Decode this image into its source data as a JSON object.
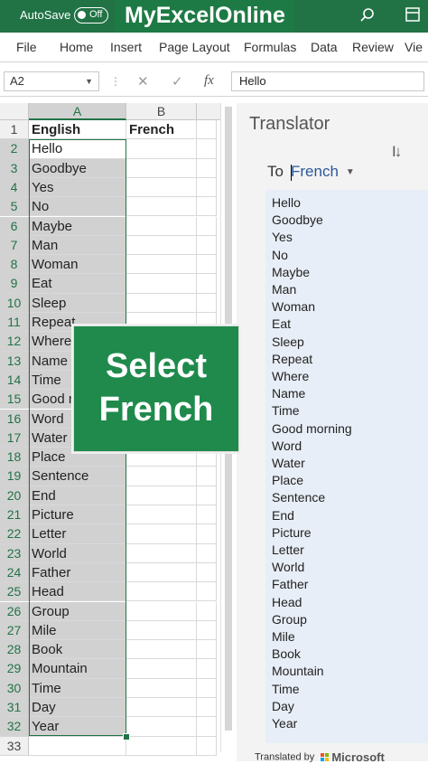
{
  "titlebar": {
    "autosave_label": "AutoSave",
    "toggle_state": "Off",
    "brand": "MyExcelOnline"
  },
  "ribbon": {
    "tabs": [
      "File",
      "Home",
      "Insert",
      "Page Layout",
      "Formulas",
      "Data",
      "Review",
      "Vie"
    ]
  },
  "formula_bar": {
    "name_box": "A2",
    "fx": "fx",
    "value": "Hello"
  },
  "columns": [
    "A",
    "B"
  ],
  "rows": [
    {
      "n": "1",
      "a": "English",
      "b": "French"
    },
    {
      "n": "2",
      "a": "Hello",
      "b": ""
    },
    {
      "n": "3",
      "a": "Goodbye",
      "b": ""
    },
    {
      "n": "4",
      "a": "Yes",
      "b": ""
    },
    {
      "n": "5",
      "a": "No",
      "b": ""
    },
    {
      "n": "6",
      "a": "Maybe",
      "b": ""
    },
    {
      "n": "7",
      "a": "Man",
      "b": ""
    },
    {
      "n": "8",
      "a": "Woman",
      "b": ""
    },
    {
      "n": "9",
      "a": "Eat",
      "b": ""
    },
    {
      "n": "10",
      "a": "Sleep",
      "b": ""
    },
    {
      "n": "11",
      "a": "Repeat",
      "b": ""
    },
    {
      "n": "12",
      "a": "Where",
      "b": ""
    },
    {
      "n": "13",
      "a": "Name",
      "b": ""
    },
    {
      "n": "14",
      "a": "Time",
      "b": ""
    },
    {
      "n": "15",
      "a": "Good m",
      "b": ""
    },
    {
      "n": "16",
      "a": "Word",
      "b": ""
    },
    {
      "n": "17",
      "a": "Water",
      "b": ""
    },
    {
      "n": "18",
      "a": "Place",
      "b": ""
    },
    {
      "n": "19",
      "a": "Sentence",
      "b": ""
    },
    {
      "n": "20",
      "a": "End",
      "b": ""
    },
    {
      "n": "21",
      "a": "Picture",
      "b": ""
    },
    {
      "n": "22",
      "a": "Letter",
      "b": ""
    },
    {
      "n": "23",
      "a": "World",
      "b": ""
    },
    {
      "n": "24",
      "a": "Father",
      "b": ""
    },
    {
      "n": "25",
      "a": "Head",
      "b": ""
    },
    {
      "n": "26",
      "a": "Group",
      "b": ""
    },
    {
      "n": "27",
      "a": "Mile",
      "b": ""
    },
    {
      "n": "28",
      "a": "Book",
      "b": ""
    },
    {
      "n": "29",
      "a": "Mountain",
      "b": ""
    },
    {
      "n": "30",
      "a": "Time",
      "b": ""
    },
    {
      "n": "31",
      "a": "Day",
      "b": ""
    },
    {
      "n": "32",
      "a": "Year",
      "b": ""
    },
    {
      "n": "33",
      "a": "",
      "b": ""
    }
  ],
  "translator": {
    "title": "Translator",
    "to_label": "To",
    "language": "French",
    "source_words": [
      "Hello",
      "Goodbye",
      "Yes",
      "No",
      "Maybe",
      "Man",
      "Woman",
      "Eat",
      "Sleep",
      "Repeat",
      "Where",
      "Name",
      "Time",
      "Good morning",
      "Word",
      "Water",
      "Place",
      "Sentence",
      "End",
      "Picture",
      "Letter",
      "World",
      "Father",
      "Head",
      "Group",
      "Mile",
      "Book",
      "Mountain",
      "Time",
      "Day",
      "Year"
    ],
    "translated_by": "Translated by",
    "provider": "Microsoft"
  },
  "overlay": {
    "line1": "Select",
    "line2": "French"
  },
  "colors": {
    "excel_green": "#217346",
    "overlay_green": "#1f8a4c",
    "link_blue": "#2b579a"
  }
}
